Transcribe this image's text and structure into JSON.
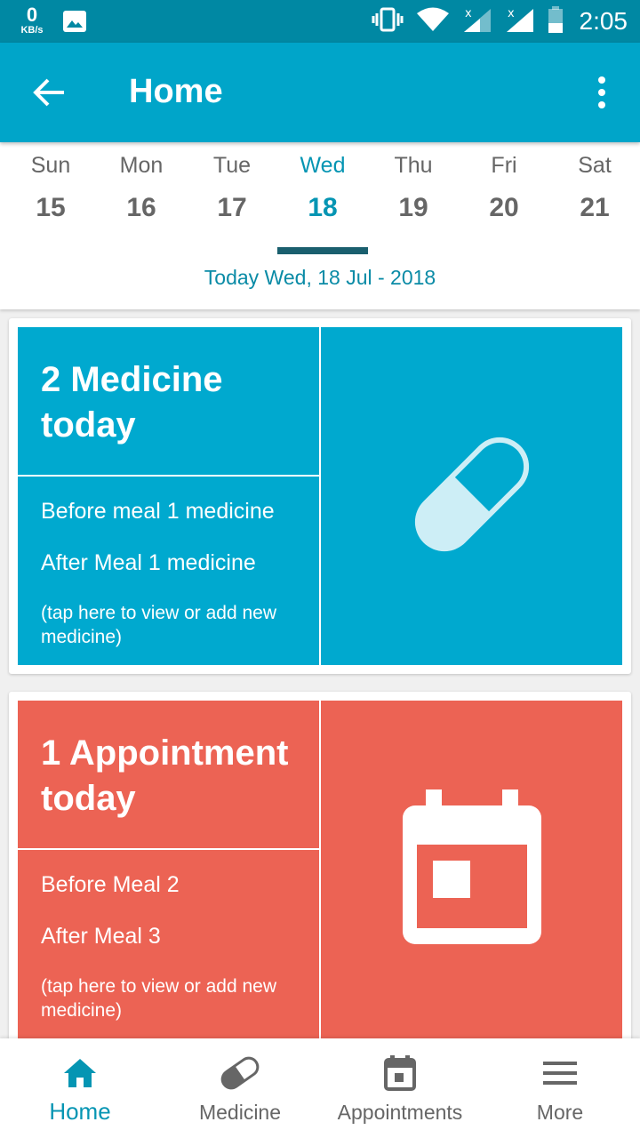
{
  "status_bar": {
    "net_speed_value": "0",
    "net_speed_unit": "KB/s",
    "time": "2:05",
    "icons": [
      "gallery-icon",
      "vibrate-icon",
      "wifi-icon",
      "signal-icon",
      "signal-icon",
      "battery-icon"
    ]
  },
  "app_bar": {
    "title": "Home",
    "back_icon": "arrow-back-icon",
    "menu_icon": "more-vert-icon"
  },
  "week": {
    "days": [
      {
        "name": "Sun",
        "date": "15"
      },
      {
        "name": "Mon",
        "date": "16"
      },
      {
        "name": "Tue",
        "date": "17"
      },
      {
        "name": "Wed",
        "date": "18"
      },
      {
        "name": "Thu",
        "date": "19"
      },
      {
        "name": "Fri",
        "date": "20"
      },
      {
        "name": "Sat",
        "date": "21"
      }
    ],
    "selected_index": 3,
    "today_label": "Today Wed, 18 Jul - 2018"
  },
  "medicine_card": {
    "heading": "2 Medicine today",
    "line1": "Before meal 1 medicine",
    "line2": "After Meal 1 medicine",
    "hint": "(tap here to view or add new medicine)",
    "icon": "pill-icon",
    "color": "#00a9cf"
  },
  "appointment_card": {
    "heading": "1 Appointment today",
    "line1": "Before Meal 2",
    "line2": "After Meal 3",
    "hint": "(tap here to view or add new medicine)",
    "icon": "calendar-icon",
    "color": "#ec6354"
  },
  "bottom_nav": {
    "items": [
      {
        "label": "Home",
        "icon": "home-icon",
        "active": true
      },
      {
        "label": "Medicine",
        "icon": "pill-icon",
        "active": false
      },
      {
        "label": "Appointments",
        "icon": "calendar-icon",
        "active": false
      },
      {
        "label": "More",
        "icon": "menu-icon",
        "active": false
      }
    ]
  },
  "colors": {
    "primary": "#00a5c9",
    "status_bar": "#0088a3",
    "accent_text": "#0595b3",
    "selected_indicator": "#1a5f6e",
    "inactive": "#666666"
  }
}
